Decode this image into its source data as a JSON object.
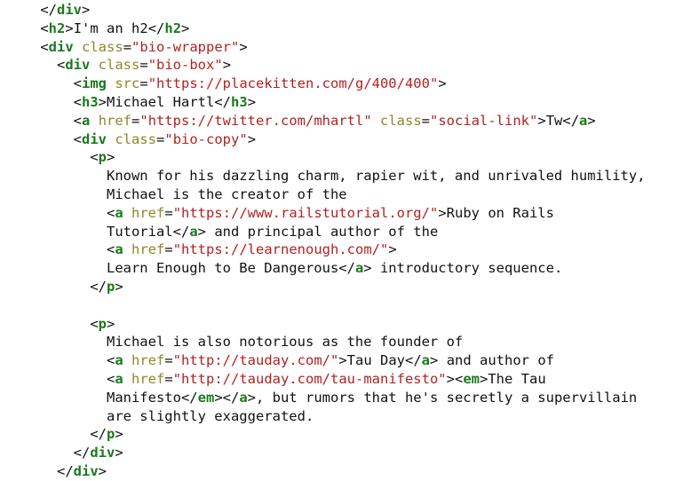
{
  "editor": {
    "colors": {
      "tag": "#1b7a1b",
      "attribute": "#8a8a2a",
      "string": "#b22222",
      "text": "#111111",
      "background": "#ffffff"
    },
    "lines": [
      [
        [
          "punc",
          "    </"
        ],
        [
          "tag",
          "div"
        ],
        [
          "punc",
          ">"
        ]
      ],
      [
        [
          "punc",
          "    <"
        ],
        [
          "tag",
          "h2"
        ],
        [
          "punc",
          ">"
        ],
        [
          "text",
          "I'm an h2"
        ],
        [
          "punc",
          "</"
        ],
        [
          "tag",
          "h2"
        ],
        [
          "punc",
          ">"
        ]
      ],
      [
        [
          "punc",
          "    <"
        ],
        [
          "tag",
          "div"
        ],
        [
          "punc",
          " "
        ],
        [
          "attr",
          "class"
        ],
        [
          "punc",
          "="
        ],
        [
          "str",
          "\"bio-wrapper\""
        ],
        [
          "punc",
          ">"
        ]
      ],
      [
        [
          "punc",
          "      <"
        ],
        [
          "tag",
          "div"
        ],
        [
          "punc",
          " "
        ],
        [
          "attr",
          "class"
        ],
        [
          "punc",
          "="
        ],
        [
          "str",
          "\"bio-box\""
        ],
        [
          "punc",
          ">"
        ]
      ],
      [
        [
          "punc",
          "        <"
        ],
        [
          "tag",
          "img"
        ],
        [
          "punc",
          " "
        ],
        [
          "attr",
          "src"
        ],
        [
          "punc",
          "="
        ],
        [
          "str",
          "\"https://placekitten.com/g/400/400\""
        ],
        [
          "punc",
          ">"
        ]
      ],
      [
        [
          "punc",
          "        <"
        ],
        [
          "tag",
          "h3"
        ],
        [
          "punc",
          ">"
        ],
        [
          "text",
          "Michael Hartl"
        ],
        [
          "punc",
          "</"
        ],
        [
          "tag",
          "h3"
        ],
        [
          "punc",
          ">"
        ]
      ],
      [
        [
          "punc",
          "        <"
        ],
        [
          "tag",
          "a"
        ],
        [
          "punc",
          " "
        ],
        [
          "attr",
          "href"
        ],
        [
          "punc",
          "="
        ],
        [
          "str",
          "\"https://twitter.com/mhartl\""
        ],
        [
          "punc",
          " "
        ],
        [
          "attr",
          "class"
        ],
        [
          "punc",
          "="
        ],
        [
          "str",
          "\"social-link\""
        ],
        [
          "punc",
          ">"
        ],
        [
          "text",
          "Tw"
        ],
        [
          "punc",
          "</"
        ],
        [
          "tag",
          "a"
        ],
        [
          "punc",
          ">"
        ]
      ],
      [
        [
          "punc",
          "        <"
        ],
        [
          "tag",
          "div"
        ],
        [
          "punc",
          " "
        ],
        [
          "attr",
          "class"
        ],
        [
          "punc",
          "="
        ],
        [
          "str",
          "\"bio-copy\""
        ],
        [
          "punc",
          ">"
        ]
      ],
      [
        [
          "punc",
          "          <"
        ],
        [
          "tag",
          "p"
        ],
        [
          "punc",
          ">"
        ]
      ],
      [
        [
          "text",
          "            Known for his dazzling charm, rapier wit, and unrivaled humility,"
        ]
      ],
      [
        [
          "text",
          "            Michael is the creator of the"
        ]
      ],
      [
        [
          "punc",
          "            <"
        ],
        [
          "tag",
          "a"
        ],
        [
          "punc",
          " "
        ],
        [
          "attr",
          "href"
        ],
        [
          "punc",
          "="
        ],
        [
          "str",
          "\"https://www.railstutorial.org/\""
        ],
        [
          "punc",
          ">"
        ],
        [
          "text",
          "Ruby on Rails"
        ]
      ],
      [
        [
          "text",
          "            Tutorial"
        ],
        [
          "punc",
          "</"
        ],
        [
          "tag",
          "a"
        ],
        [
          "punc",
          ">"
        ],
        [
          "text",
          " and principal author of the"
        ]
      ],
      [
        [
          "punc",
          "            <"
        ],
        [
          "tag",
          "a"
        ],
        [
          "punc",
          " "
        ],
        [
          "attr",
          "href"
        ],
        [
          "punc",
          "="
        ],
        [
          "str",
          "\"https://learnenough.com/\""
        ],
        [
          "punc",
          ">"
        ]
      ],
      [
        [
          "text",
          "            Learn Enough to Be Dangerous"
        ],
        [
          "punc",
          "</"
        ],
        [
          "tag",
          "a"
        ],
        [
          "punc",
          ">"
        ],
        [
          "text",
          " introductory sequence."
        ]
      ],
      [
        [
          "punc",
          "          </"
        ],
        [
          "tag",
          "p"
        ],
        [
          "punc",
          ">"
        ]
      ],
      [],
      [
        [
          "punc",
          "          <"
        ],
        [
          "tag",
          "p"
        ],
        [
          "punc",
          ">"
        ]
      ],
      [
        [
          "text",
          "            Michael is also notorious as the founder of"
        ]
      ],
      [
        [
          "punc",
          "            <"
        ],
        [
          "tag",
          "a"
        ],
        [
          "punc",
          " "
        ],
        [
          "attr",
          "href"
        ],
        [
          "punc",
          "="
        ],
        [
          "str",
          "\"http://tauday.com/\""
        ],
        [
          "punc",
          ">"
        ],
        [
          "text",
          "Tau Day"
        ],
        [
          "punc",
          "</"
        ],
        [
          "tag",
          "a"
        ],
        [
          "punc",
          ">"
        ],
        [
          "text",
          " and author of"
        ]
      ],
      [
        [
          "punc",
          "            <"
        ],
        [
          "tag",
          "a"
        ],
        [
          "punc",
          " "
        ],
        [
          "attr",
          "href"
        ],
        [
          "punc",
          "="
        ],
        [
          "str",
          "\"http://tauday.com/tau-manifesto\""
        ],
        [
          "punc",
          "><"
        ],
        [
          "tag",
          "em"
        ],
        [
          "punc",
          ">"
        ],
        [
          "text",
          "The Tau"
        ]
      ],
      [
        [
          "text",
          "            Manifesto"
        ],
        [
          "punc",
          "</"
        ],
        [
          "tag",
          "em"
        ],
        [
          "punc",
          "></"
        ],
        [
          "tag",
          "a"
        ],
        [
          "punc",
          ">"
        ],
        [
          "text",
          ", but rumors that he's secretly a supervillain"
        ]
      ],
      [
        [
          "text",
          "            are slightly exaggerated."
        ]
      ],
      [
        [
          "punc",
          "          </"
        ],
        [
          "tag",
          "p"
        ],
        [
          "punc",
          ">"
        ]
      ],
      [
        [
          "punc",
          "        </"
        ],
        [
          "tag",
          "div"
        ],
        [
          "punc",
          ">"
        ]
      ],
      [
        [
          "punc",
          "      </"
        ],
        [
          "tag",
          "div"
        ],
        [
          "punc",
          ">"
        ]
      ]
    ]
  }
}
